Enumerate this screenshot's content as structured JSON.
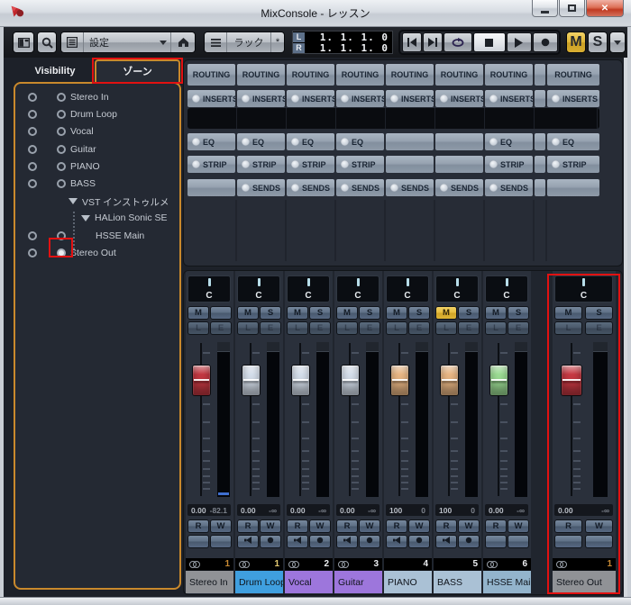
{
  "window": {
    "title": "MixConsole - レッスン",
    "minimize": "minimize",
    "maximize": "maximize",
    "close": "close"
  },
  "toolbar": {
    "preset_label": "設定",
    "rack_label": "ラック",
    "star_label": "*",
    "meter_left_label": "L",
    "meter_right_label": "R",
    "time_left": "1. 1. 1. 0",
    "time_right": "1. 1. 1. 0",
    "transport": [
      {
        "icon": "skip-start-icon",
        "state": "normal"
      },
      {
        "icon": "skip-end-icon",
        "state": "normal"
      },
      {
        "icon": "cycle-icon",
        "state": "purple"
      },
      {
        "icon": "stop-icon",
        "state": "lit"
      },
      {
        "icon": "play-icon",
        "state": "normal"
      },
      {
        "icon": "record-icon",
        "state": "normal"
      }
    ],
    "mute_label": "M",
    "solo_label": "S"
  },
  "left_panel": {
    "tabs": [
      {
        "label": "Visibility"
      },
      {
        "label": "ゾーン",
        "selected": true,
        "annotated": true
      }
    ],
    "rows": [
      {
        "label": "Stereo In",
        "type": "channel",
        "indent": 0,
        "left_on": false,
        "right_on": false
      },
      {
        "label": "Drum Loop",
        "type": "channel",
        "indent": 0,
        "left_on": false,
        "right_on": false
      },
      {
        "label": "Vocal",
        "type": "channel",
        "indent": 0,
        "left_on": false,
        "right_on": false
      },
      {
        "label": "Guitar",
        "type": "channel",
        "indent": 0,
        "left_on": false,
        "right_on": false
      },
      {
        "label": "PIANO",
        "type": "channel",
        "indent": 0,
        "left_on": false,
        "right_on": false
      },
      {
        "label": "BASS",
        "type": "channel",
        "indent": 0,
        "left_on": false,
        "right_on": false
      },
      {
        "label": "VST インストゥルメ",
        "type": "folder",
        "indent": 1
      },
      {
        "label": "HALion Sonic SE",
        "type": "folder",
        "indent": 2
      },
      {
        "label": "HSSE Main",
        "type": "channel",
        "indent": 2,
        "left_on": false,
        "right_on": false
      },
      {
        "label": "Stereo Out",
        "type": "channel",
        "indent": 0,
        "left_on": false,
        "right_on": true,
        "annotated": true
      }
    ]
  },
  "rack": {
    "rows": [
      {
        "id": "routing",
        "label": "ROUTING",
        "led": false,
        "cells": [
          1,
          1,
          1,
          1,
          1,
          1,
          1,
          1
        ]
      },
      {
        "id": "inserts",
        "label": "INSERTS",
        "led": true,
        "cells": [
          1,
          1,
          1,
          1,
          1,
          1,
          1,
          1
        ]
      },
      {
        "id": "eq",
        "label": "EQ",
        "led": true,
        "cells": [
          1,
          1,
          1,
          1,
          0,
          0,
          1,
          1
        ]
      },
      {
        "id": "strip",
        "label": "STRIP",
        "led": true,
        "cells": [
          1,
          1,
          1,
          1,
          0,
          0,
          1,
          1
        ]
      },
      {
        "id": "sends",
        "label": "SENDS",
        "led": true,
        "cells": [
          0,
          1,
          1,
          1,
          1,
          1,
          1,
          0
        ]
      }
    ]
  },
  "mixer": {
    "labels": {
      "mute": "M",
      "solo": "S",
      "listen": "L",
      "edit": "E",
      "read": "R",
      "write": "W",
      "pan": "C"
    },
    "channels": [
      {
        "name": "Stereo In",
        "number": "1",
        "number_color": "#c98b33",
        "stereo_icon": true,
        "color": "#909296",
        "fader_color": "#cc3a44",
        "value": "0.00",
        "meter_value": "-82.1",
        "has_solo": false,
        "mute_on": false,
        "has_monitor": false,
        "meter_signal": true
      },
      {
        "name": "Drum Loop",
        "number": "1",
        "number_color": "#e7cd74",
        "stereo_icon": true,
        "color": "#3f9fdf",
        "fader_color": "#dfe9f6",
        "value": "0.00",
        "meter_value": "-∞",
        "has_solo": true,
        "mute_on": false,
        "has_monitor": true,
        "meter_signal": false
      },
      {
        "name": "Vocal",
        "number": "2",
        "number_color": "#eceef1",
        "stereo_icon": true,
        "color": "#9d76dc",
        "fader_color": "#dfe9f6",
        "value": "0.00",
        "meter_value": "-∞",
        "has_solo": true,
        "mute_on": false,
        "has_monitor": true,
        "meter_signal": false
      },
      {
        "name": "Guitar",
        "number": "3",
        "number_color": "#eceef1",
        "stereo_icon": true,
        "color": "#9d76dc",
        "fader_color": "#dfe9f6",
        "value": "0.00",
        "meter_value": "-∞",
        "has_solo": true,
        "mute_on": false,
        "has_monitor": true,
        "meter_signal": false
      },
      {
        "name": "PIANO",
        "number": "4",
        "number_color": "#eceef1",
        "stereo_icon": false,
        "color": "#aac1d5",
        "fader_color": "#f4bf8a",
        "value": "100",
        "meter_value": "0",
        "has_solo": true,
        "mute_on": false,
        "has_monitor": true,
        "meter_signal": false
      },
      {
        "name": "BASS",
        "number": "5",
        "number_color": "#eceef1",
        "stereo_icon": false,
        "color": "#aac1d5",
        "fader_color": "#f4bf8a",
        "value": "100",
        "meter_value": "0",
        "has_solo": true,
        "mute_on": true,
        "has_monitor": true,
        "meter_signal": false
      },
      {
        "name": "HSSE Main",
        "number": "6",
        "number_color": "#eceef1",
        "stereo_icon": true,
        "color": "#93b4cc",
        "fader_color": "#a3e69a",
        "value": "0.00",
        "meter_value": "-∞",
        "has_solo": true,
        "mute_on": false,
        "has_monitor": false,
        "meter_signal": false
      },
      {
        "name": "Stereo Out",
        "number": "1",
        "number_color": "#c98b33",
        "stereo_icon": true,
        "color": "#909296",
        "fader_color": "#cc3a44",
        "value": "0.00",
        "meter_value": "-∞",
        "has_solo": true,
        "mute_on": false,
        "has_monitor": false,
        "meter_signal": false,
        "annotated": true
      }
    ]
  },
  "colors": {
    "annotation_red": "#e21111",
    "zone_border_orange": "#c9892c",
    "mute_yellow": "#e5bb3c",
    "cycle_purple": "#7c68cc"
  }
}
